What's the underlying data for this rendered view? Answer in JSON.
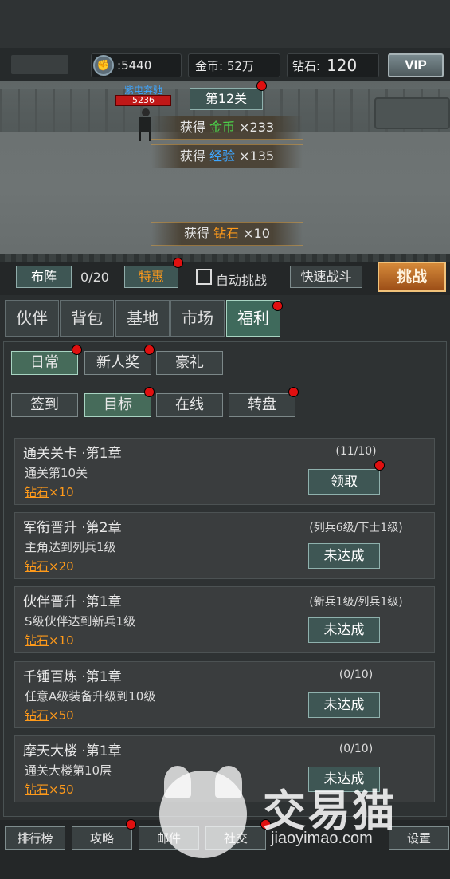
{
  "resources": {
    "power": "5440",
    "gold": "金币: 52万",
    "diamond_label": "钻石:",
    "diamond_value": "120",
    "vip": "VIP"
  },
  "battle": {
    "enemy_name": "紫电奔驰",
    "enemy_hp": "5236",
    "stage": "第12关",
    "rewards": [
      {
        "prefix": "获得 ",
        "item": "金币",
        "suffix": " ×233"
      },
      {
        "prefix": "获得 ",
        "item": "经验",
        "suffix": " ×135"
      },
      {
        "prefix": "获得 ",
        "item": "钻石",
        "suffix": " ×10"
      }
    ]
  },
  "actions": {
    "formation": "布阵",
    "count": "0/20",
    "special": "特惠",
    "auto_challenge": "自动挑战",
    "quick_battle": "快速战斗",
    "challenge": "挑战"
  },
  "tabs": [
    "伙伴",
    "背包",
    "基地",
    "市场",
    "福利"
  ],
  "subtabs_row1": [
    "日常",
    "新人奖",
    "豪礼"
  ],
  "subtabs_row2": [
    "签到",
    "目标",
    "在线",
    "转盘"
  ],
  "tasks": [
    {
      "title": "通关关卡 ·第1章",
      "desc": "通关第10关",
      "reward_item": "钻石",
      "reward_qty": "×10",
      "progress": "(11/10)",
      "button": "领取"
    },
    {
      "title": "军衔晋升 ·第2章",
      "desc": "主角达到列兵1级",
      "reward_item": "钻石",
      "reward_qty": "×20",
      "progress": "(列兵6级/下士1级)",
      "button": "未达成"
    },
    {
      "title": "伙伴晋升 ·第1章",
      "desc": "S级伙伴达到新兵1级",
      "reward_item": "钻石",
      "reward_qty": "×10",
      "progress": "(新兵1级/列兵1级)",
      "button": "未达成"
    },
    {
      "title": "千锤百炼 ·第1章",
      "desc": "任意A级装备升级到10级",
      "reward_item": "钻石",
      "reward_qty": "×50",
      "progress": "(0/10)",
      "button": "未达成"
    },
    {
      "title": "摩天大楼 ·第1章",
      "desc": "通关大楼第10层",
      "reward_item": "钻石",
      "reward_qty": "×50",
      "progress": "(0/10)",
      "button": "未达成"
    }
  ],
  "bottom_nav": [
    "排行榜",
    "攻略",
    "邮件",
    "社交",
    "设置"
  ],
  "watermark": {
    "title": "交易猫",
    "url": "jiaoyimao.com"
  },
  "colors": {
    "accent_green": "#466b5a",
    "reward_orange": "#ff9a1a",
    "notify_red": "#e01010",
    "challenge_orange": "#d58a3a"
  }
}
